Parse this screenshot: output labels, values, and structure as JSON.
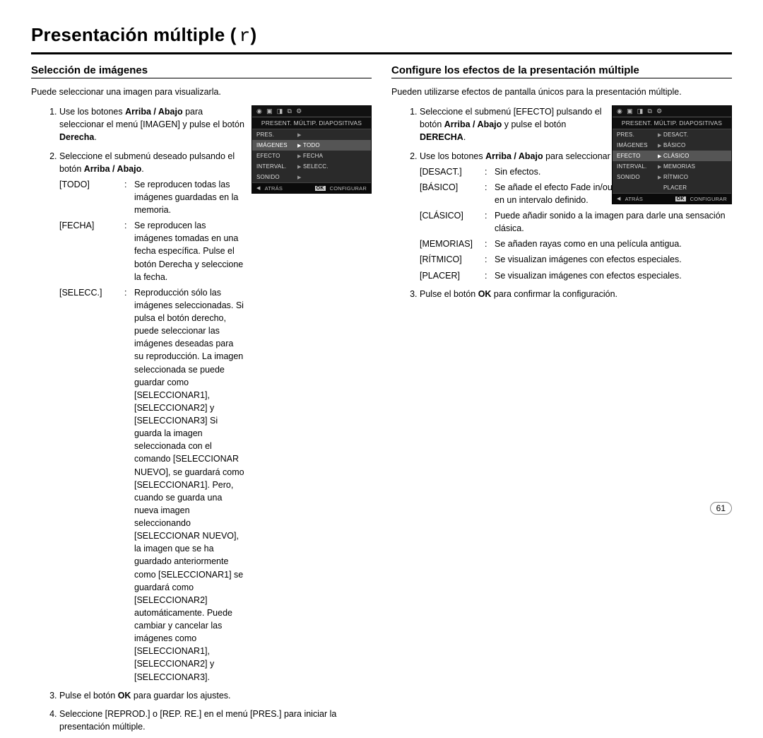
{
  "page_title": "Presentación múltiple (",
  "page_title_icon": "r",
  "page_title_close": ")",
  "page_number": "61",
  "left": {
    "heading": "Selección de imágenes",
    "intro": "Puede seleccionar una imagen para visualizarla.",
    "steps": {
      "s1a": "Use los botones ",
      "s1b": "Arriba / Abajo",
      "s1c": " para seleccionar el menú [IMAGEN] y pulse el botón ",
      "s1d": "Derecha",
      "s1e": ".",
      "s2a": "Seleccione el submenú deseado pulsando el botón ",
      "s2b": "Arriba / Abajo",
      "s2c": ".",
      "s3a": "Pulse el botón ",
      "s3b": "OK",
      "s3c": " para guardar los ajustes.",
      "s4": "Seleccione [REPROD.] o [REP. RE.] en el menú [PRES.] para iniciar la presentación múltiple."
    },
    "defs": {
      "todo": {
        "term": "[TODO]",
        "desc": "Se reproducen todas las imágenes guardadas en la memoria."
      },
      "fecha": {
        "term": "[FECHA]",
        "desc": "Se reproducen las imágenes tomadas en una fecha específica. Pulse el botón Derecha y seleccione la fecha."
      },
      "selecc": {
        "term": "[SELECC.]",
        "desc": "Reproducción sólo las imágenes seleccionadas. Si pulsa el botón derecho, puede seleccionar las imágenes deseadas para su reproducción. La imagen seleccionada se puede guardar como [SELECCIONAR1], [SELECCIONAR2] y [SELECCIONAR3] Si guarda la imagen seleccionada con el comando [SELECCIONAR NUEVO], se guardará como [SELECCIONAR1]. Pero, cuando se guarda una nueva imagen seleccionando [SELECCIONAR NUEVO], la imagen que se ha guardado anteriormente como [SELECCIONAR1] se guardará como [SELECCIONAR2] automáticamente. Puede cambiar y cancelar las imágenes como [SELECCIONAR1], [SELECCIONAR2] y [SELECCIONAR3]."
      }
    },
    "screen": {
      "title": "PRESENT. MÚLTIP. DIAPOSITIVAS",
      "rows": [
        {
          "l": "PRES.",
          "r": ""
        },
        {
          "l": "IMÁGENES",
          "r": "TODO"
        },
        {
          "l": "EFECTO",
          "r": "FECHA"
        },
        {
          "l": "INTERVAL.",
          "r": "SELECC."
        },
        {
          "l": "SONIDO",
          "r": ""
        }
      ],
      "footer": {
        "back": "ATRÁS",
        "ok": "OK",
        "action": "CONFIGURAR"
      }
    }
  },
  "right": {
    "heading": "Configure los efectos de la presentación múltiple",
    "intro": "Pueden utilizarse efectos de pantalla únicos para la presentación múltiple.",
    "steps": {
      "s1a": "Seleccione el submenú [EFECTO] pulsando el botón ",
      "s1b": "Arriba / Abajo",
      "s1c": " y pulse el botón ",
      "s1d": "DERECHA",
      "s1e": ".",
      "s2a": "Use los botones ",
      "s2b": "Arriba / Abajo",
      "s2c": " para seleccionar el tipo de efecto.",
      "s3a": "Pulse el botón ",
      "s3b": "OK",
      "s3c": " para confirmar la configuración."
    },
    "defs": {
      "desact": {
        "term": "[DESACT.]",
        "desc": "Sin efectos."
      },
      "basico": {
        "term": "[BÁSICO]",
        "desc": "Se añade el efecto Fade in/out y las imágenes se muestran en un intervalo definido."
      },
      "clasico": {
        "term": "[CLÁSICO]",
        "desc": "Puede añadir sonido a la imagen para darle una sensación clásica."
      },
      "memorias": {
        "term": "[MEMORIAS]",
        "desc": "Se añaden rayas como en una película antigua."
      },
      "ritmico": {
        "term": "[RÍTMICO]",
        "desc": "Se visualizan imágenes con efectos especiales."
      },
      "placer": {
        "term": "[PLACER]",
        "desc": "Se visualizan imágenes con efectos especiales."
      }
    },
    "screen": {
      "title": "PRESENT. MÚLTIP. DIAPOSITIVAS",
      "rows": [
        {
          "l": "PRES.",
          "r": "DESACT."
        },
        {
          "l": "IMÁGENES",
          "r": "BÁSICO"
        },
        {
          "l": "EFECTO",
          "r": "CLÁSICO"
        },
        {
          "l": "INTERVAL.",
          "r": "MEMORIAS"
        },
        {
          "l": "SONIDO",
          "r": "RÍTMICO"
        },
        {
          "l": "",
          "r": "PLACER"
        }
      ],
      "footer": {
        "back": "ATRÁS",
        "ok": "OK",
        "action": "CONFIGURAR"
      }
    }
  }
}
